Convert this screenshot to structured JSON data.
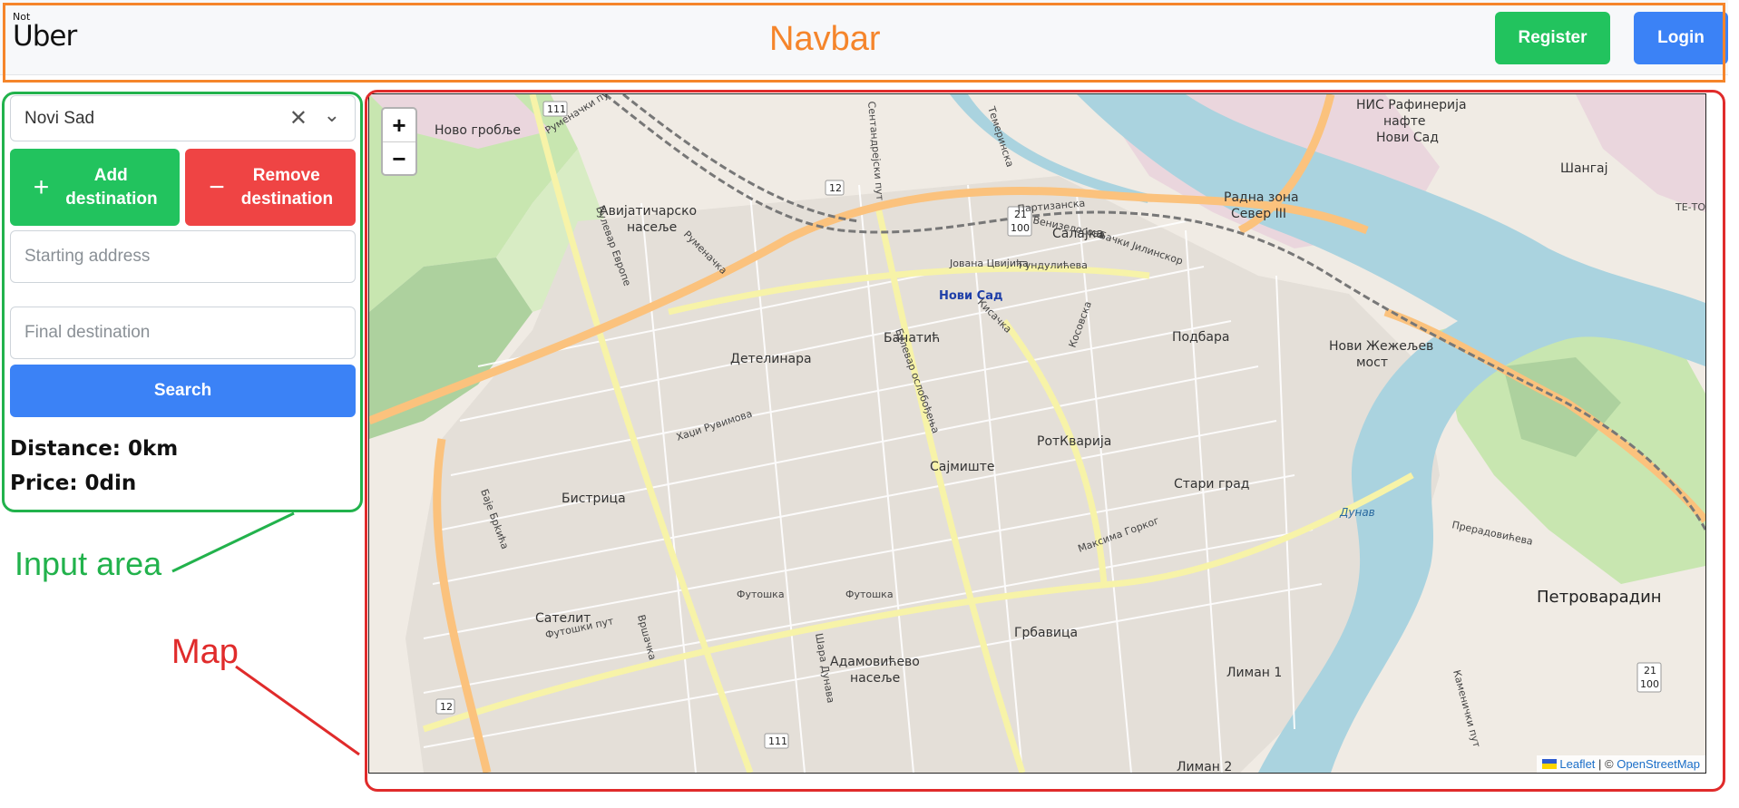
{
  "navbar": {
    "logo_small": "Not",
    "logo_big": "Uber",
    "annotation_label": "Navbar",
    "register_label": "Register",
    "login_label": "Login"
  },
  "input_area": {
    "annotation_label": "Input area",
    "city_select": {
      "value": "Novi Sad",
      "clear_icon": "close-icon",
      "dropdown_icon": "chevron-down-icon"
    },
    "add_destination_label": "Add destination",
    "remove_destination_label": "Remove destination",
    "starting_address_placeholder": "Starting address",
    "final_destination_placeholder": "Final destination",
    "search_label": "Search",
    "distance_text": "Distance: 0km",
    "price_text": "Price: 0din"
  },
  "map": {
    "annotation_label": "Map",
    "zoom_in": "+",
    "zoom_out": "−",
    "attribution": {
      "leaflet": "Leaflet",
      "separator": " | © ",
      "osm": "OpenStreetMap"
    },
    "places": {
      "novo_groblje": "Ново гробље",
      "avijaticarsko": "Авијатичарско",
      "naselje": "насеље",
      "detelinara": "Детелинара",
      "banatic": "Банатић",
      "salajka": "Салајка",
      "novi_sad": "Нови Сад",
      "podbara": "Подбара",
      "rotkvarija": "РотКварија",
      "sajmiste": "Сајмиште",
      "stari_grad": "Стари град",
      "bistrica": "Бистрица",
      "satelit": "Сателит",
      "grbavica": "Грбавица",
      "adamovicevo": "Адамовићево",
      "adamovicevo_naselje": "насеље",
      "liman1": "Лиман 1",
      "liman2": "Лиман 2",
      "petrovaradin": "Петроварадин",
      "radna_zona": "Радна зона",
      "sever3": "Север III",
      "nis1": "НИС Рафинерија",
      "nis2": "нафте",
      "nis3": "Нови Сад",
      "sangaj": "Шангај",
      "most1": "Нови Жежељев",
      "most2": "мост",
      "dunav": "Дунав",
      "te_to": "ТЕ-ТО"
    },
    "streets": {
      "partizanska": "Партизанска",
      "futoska": "Футошка",
      "futoski_put": "Футошки пут",
      "bulevar_evrope": "Булевар Европе",
      "bulevar_oslobodjenja": "Булевар ослобођења",
      "rumenacka": "Руменачка",
      "jovana_cvijica": "Јована Цвијића",
      "venizelosova": "Венизелосова",
      "kisacka": "Кисачка",
      "kosovska": "Косовска",
      "maksima_gorkog": "Максима Горког",
      "vrsacka": "Вршачка",
      "hadzi_ruvimova": "Хаџи Рувимова",
      "preradoviceva": "Прерадовићева",
      "kamenicki_put": "Каменички пут",
      "baje_brkica": "Баје Брkића",
      "temerinska": "Темеринска",
      "sentandrejski": "Сентандрејски пут",
      "gundulicева": "Гундулићева",
      "backi_jilinski": "Бачки Јилинскор",
      "rumenacki_put": "Руменачки пут",
      "sarplaninska": "Шара Дунава"
    },
    "shields": {
      "r111": "111",
      "r12": "12",
      "r21": "21",
      "r100": "100"
    }
  },
  "colors": {
    "navbar_annotation": "#f5852b",
    "input_annotation": "#22b24c",
    "map_annotation": "#e02b2b",
    "green_button": "#22c35e",
    "red_button": "#ef4444",
    "blue_button": "#3b82f6",
    "river": "#aad3df"
  }
}
